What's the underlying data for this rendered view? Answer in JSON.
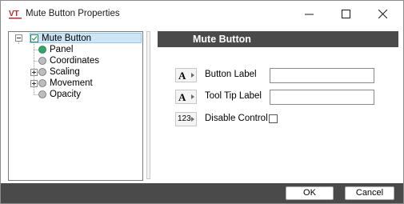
{
  "window": {
    "title": "Mute Button Properties",
    "logo_text": "VT",
    "controls": [
      "minimize",
      "maximize",
      "close"
    ]
  },
  "tree": {
    "root": {
      "label": "Mute Button",
      "expanded": true,
      "icon": "checkbox-square-icon"
    },
    "children": [
      {
        "label": "Panel",
        "icon": "green-dot-icon",
        "expandable": false
      },
      {
        "label": "Coordinates",
        "icon": "gray-dot-icon",
        "expandable": false
      },
      {
        "label": "Scaling",
        "icon": "gray-dot-icon",
        "expandable": true
      },
      {
        "label": "Movement",
        "icon": "gray-dot-icon",
        "expandable": true
      },
      {
        "label": "Opacity",
        "icon": "gray-dot-icon",
        "expandable": false
      }
    ]
  },
  "properties": {
    "header": "Mute Button",
    "rows": [
      {
        "label": "Button Label",
        "type_glyph": "A",
        "control": "text",
        "value": ""
      },
      {
        "label": "Tool Tip Label",
        "type_glyph": "A",
        "control": "text",
        "value": ""
      },
      {
        "label": "Disable Control",
        "type_glyph": "123",
        "control": "checkbox",
        "checked": false
      }
    ]
  },
  "footer": {
    "ok_label": "OK",
    "cancel_label": "Cancel"
  },
  "colors": {
    "header_bg": "#4a4a4a",
    "footer_bg": "#4a4a4a",
    "selection_bg": "#cde6f7",
    "panel_dot": "#2fa86a",
    "logo_red": "#c4262e"
  }
}
